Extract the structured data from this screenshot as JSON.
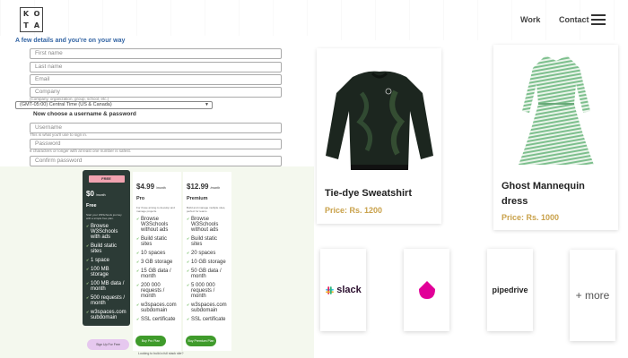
{
  "header": {
    "logo_letters": [
      "K",
      "O",
      "T",
      "A"
    ],
    "nav": {
      "work": "Work",
      "contact": "Contact"
    }
  },
  "form": {
    "heading": "A few details and you're on your way",
    "placeholders": {
      "first_name": "First name",
      "last_name": "Last name",
      "email": "Email",
      "company": "Company",
      "username": "Username",
      "password": "Password",
      "confirm_password": "Confirm password"
    },
    "company_hint": "(Company, organization, group, school, etc.)",
    "timezone": "(GMT-05:00) Central Time (US & Canada)",
    "subheading": "Now choose a username & password",
    "username_hint": "This is what you'll use to sign in.",
    "password_hint": "8 characters or longer with at least one number is safest."
  },
  "pricing": {
    "free": {
      "badge": "FREE",
      "price": "$0",
      "period": "/month",
      "name": "Free",
      "desc": "Start your W3Schools journey with a simple free plan.",
      "features": [
        "Browse W3Schools with ads",
        "Build static sites",
        "1 space",
        "100 MB storage",
        "100 MB data / month",
        "500 requests / month",
        "w3spaces.com subdomain"
      ],
      "button": "Sign Up For Free"
    },
    "pro": {
      "price": "$4.99",
      "period": "/month",
      "name": "Pro",
      "desc": "For those aiming to develop and manage projects.",
      "features": [
        "Browse W3Schools without ads",
        "Build static sites",
        "10 spaces",
        "3 GB storage",
        "15 GB data / month",
        "200 000 requests / month",
        "w3spaces.com subdomain",
        "SSL certificate"
      ],
      "button": "Buy Pro Plan",
      "note": "Looking to build a full stack site?"
    },
    "premium": {
      "price": "$12.99",
      "period": "/month",
      "name": "Premium",
      "desc": "Build and manage multiple sites, perfect for teams.",
      "features": [
        "Browse W3Schools without ads",
        "Build static sites",
        "20 spaces",
        "10 GB storage",
        "50 GB data / month",
        "5 000 000 requests / month",
        "w3spaces.com subdomain",
        "SSL certificate"
      ],
      "button": "Buy Premium Plan"
    }
  },
  "products": [
    {
      "title": "Tie-dye Sweatshirt",
      "price": "Price: Rs. 1200"
    },
    {
      "title": "Ghost Mannequin",
      "title_line2": "dress",
      "price": "Price: Rs. 1000"
    }
  ],
  "integrations": {
    "slack": "slack",
    "pipedrive": "pipedrive",
    "more": "+ more"
  }
}
